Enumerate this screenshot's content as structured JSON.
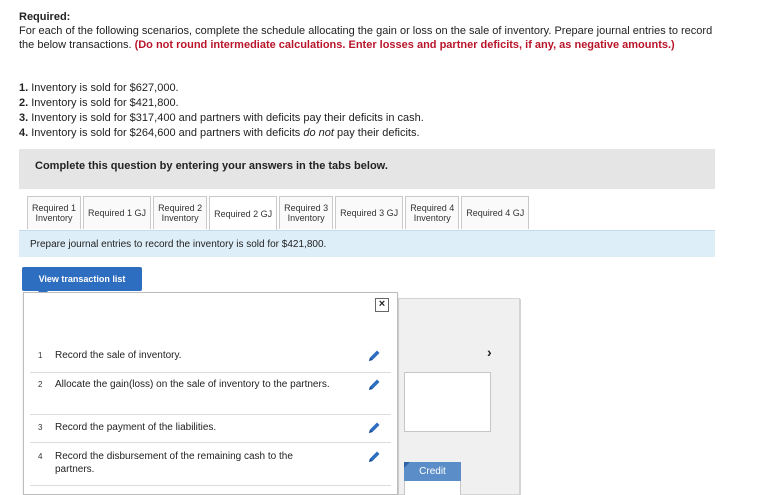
{
  "header": {
    "title": "Required:",
    "intro": "For each of the following scenarios, complete the schedule allocating the gain or loss on the sale of inventory. Prepare journal entries to record the below transactions.",
    "note": "(Do not round intermediate calculations. Enter losses and partner deficits, if any, as negative amounts.)"
  },
  "scenarios": [
    {
      "num": "1.",
      "text": "Inventory is sold for $627,000."
    },
    {
      "num": "2.",
      "text": "Inventory is sold for $421,800."
    },
    {
      "num": "3.",
      "text": "Inventory is sold for $317,400 and partners with deficits pay their deficits in cash."
    },
    {
      "num": "4.",
      "text_before": "Inventory is sold for $264,600 and partners with deficits ",
      "text_em": "do not",
      "text_after": " pay their deficits."
    }
  ],
  "question_box": {
    "label": "Complete this question by entering your answers in the tabs below."
  },
  "tabs": [
    {
      "line1": "Required 1",
      "line2": "Inventory",
      "active": false
    },
    {
      "line1": "Required 1 GJ",
      "line2": "",
      "active": false
    },
    {
      "line1": "Required 2",
      "line2": "Inventory",
      "active": false
    },
    {
      "line1": "Required 2 GJ",
      "line2": "",
      "active": true
    },
    {
      "line1": "Required 3",
      "line2": "Inventory",
      "active": false
    },
    {
      "line1": "Required 3 GJ",
      "line2": "",
      "active": false
    },
    {
      "line1": "Required 4",
      "line2": "Inventory",
      "active": false
    },
    {
      "line1": "Required 4 GJ",
      "line2": "",
      "active": false
    }
  ],
  "instruction": "Prepare journal entries to record the inventory is sold for $421,800.",
  "view_button": {
    "label": "View transaction list"
  },
  "close_icon": "close-icon",
  "transactions": [
    {
      "num": "1",
      "text": "Record the sale of inventory.",
      "icon": "pencil-icon"
    },
    {
      "num": "2",
      "text": "Allocate the gain(loss) on the sale of inventory to the partners.",
      "icon": "pencil-icon"
    },
    {
      "num": "3",
      "text": "Record the payment of the liabilities.",
      "icon": "pencil-icon"
    },
    {
      "num": "4",
      "text": "Record the disbursement of the remaining cash to the partners.",
      "icon": "pencil-icon"
    }
  ],
  "journal": {
    "credit_header": "Credit",
    "next_icon": "chevron-right-icon"
  },
  "colors": {
    "accent_blue": "#2e6ec0",
    "note_red": "#b8152a",
    "instruction_bg": "#ddeef8",
    "credit_header_bg": "#5b8ec8"
  }
}
